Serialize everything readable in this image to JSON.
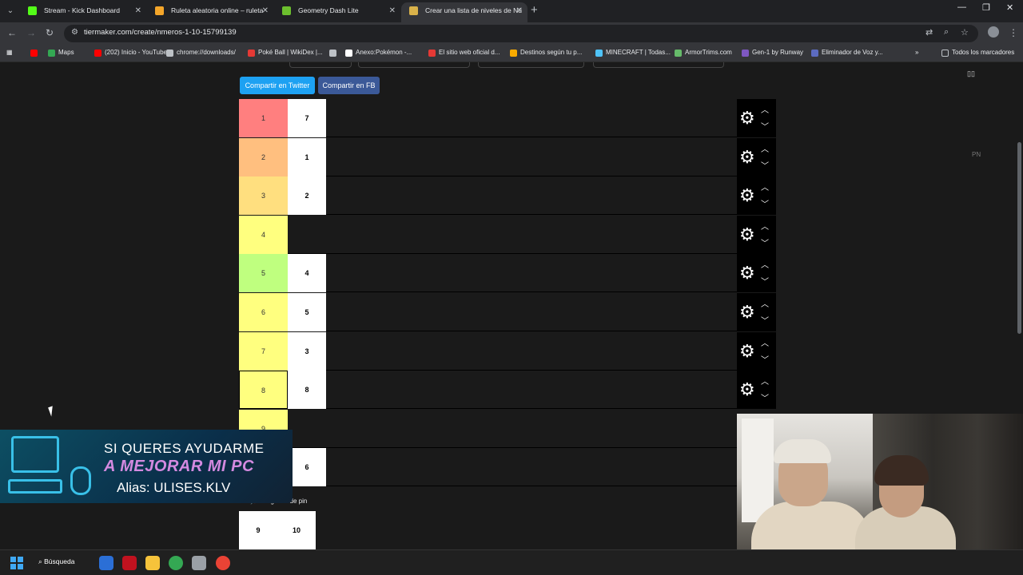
{
  "browser": {
    "tabs": [
      {
        "title": "Stream - Kick Dashboard",
        "color": "#53fc18",
        "active": false
      },
      {
        "title": "Ruleta aleatoria online – ruleta",
        "color": "#f4a62a",
        "active": false
      },
      {
        "title": "Geometry Dash Lite",
        "color": "#6cbf2e",
        "active": false
      },
      {
        "title": "Crear una lista de niveles de Nú",
        "color": "#d9b24a",
        "active": true
      }
    ],
    "new_tab": "+",
    "window_controls": {
      "minimize": "—",
      "restore": "❐",
      "close": "✕"
    },
    "url": "tiermaker.com/create/nmeros-1-10-15799139",
    "bookmarks": [
      {
        "label": "",
        "color": "#ff0000"
      },
      {
        "label": "Maps",
        "color": "#34a853"
      },
      {
        "label": "(202) Inicio - YouTube",
        "color": "#ff0000"
      },
      {
        "label": "chrome://downloads/",
        "color": "#bdc1c6"
      },
      {
        "label": "Poké Ball | WikiDex |...",
        "color": "#e53935"
      },
      {
        "label": "",
        "color": "#bdc1c6"
      },
      {
        "label": "Anexo:Pokémon -...",
        "color": "#ffffff"
      },
      {
        "label": "El sitio web oficial d...",
        "color": "#e53935"
      },
      {
        "label": "Destinos según tu p...",
        "color": "#f9ab00"
      },
      {
        "label": "MINECRAFT | Todas...",
        "color": "#4fc3f7"
      },
      {
        "label": "ArmorTrims.com",
        "color": "#66bb6a"
      },
      {
        "label": "Gen-1 by Runway",
        "color": "#7e57c2"
      },
      {
        "label": "Eliminador de Voz y...",
        "color": "#5c6bc0"
      }
    ],
    "all_bookmarks": "Todos los marcadores"
  },
  "page": {
    "share_twitter": "Compartir en Twitter",
    "share_fb": "Compartir en FB",
    "side_text": "PN",
    "tiers": [
      {
        "label": "1",
        "color": "#ff7f7f",
        "items": [
          "7"
        ]
      },
      {
        "label": "2",
        "color": "#ffbf7f",
        "items": [
          "1"
        ]
      },
      {
        "label": "3",
        "color": "#ffdf7f",
        "items": [
          "2"
        ]
      },
      {
        "label": "4",
        "color": "#ffff7f",
        "items": []
      },
      {
        "label": "5",
        "color": "#bfff7f",
        "items": [
          "4"
        ]
      },
      {
        "label": "6",
        "color": "#ffff7f",
        "items": [
          "5"
        ]
      },
      {
        "label": "7",
        "color": "#ffff7f",
        "items": [
          "3"
        ]
      },
      {
        "label": "8",
        "color": "#ffff7f",
        "items": [
          "8"
        ]
      },
      {
        "label": "9",
        "color": "#ffff7f",
        "items": []
      },
      {
        "label": "",
        "color": "#ffff7f",
        "items": [
          "6"
        ]
      }
    ],
    "pool_label": "Imágenes de pin",
    "pool_items": [
      "9",
      "10"
    ]
  },
  "overlay": {
    "line1": "SI QUERES AYUDARME",
    "line2": "A MEJORAR MI PC",
    "line3": "Alias: ULISES.KLV"
  },
  "taskbar": {
    "search": "Búsqueda",
    "apps": [
      {
        "name": "widgets",
        "color": "#2b6fd6"
      },
      {
        "name": "app-red",
        "color": "#c1121f"
      },
      {
        "name": "file-explorer",
        "color": "#f6c33b"
      },
      {
        "name": "chrome",
        "color": "#34a853"
      },
      {
        "name": "app-gray",
        "color": "#9aa0a6"
      },
      {
        "name": "chrome-active",
        "color": "#ea4335"
      }
    ]
  }
}
